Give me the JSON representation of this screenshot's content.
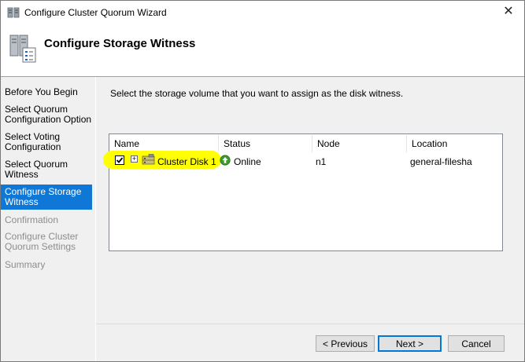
{
  "window": {
    "title": "Configure Cluster Quorum Wizard",
    "close_glyph": "✕"
  },
  "header": {
    "title": "Configure Storage Witness",
    "icon": "cluster-wizard-icon"
  },
  "nav": {
    "items": [
      {
        "label": "Before You Begin",
        "state": "normal"
      },
      {
        "label": "Select Quorum Configuration Option",
        "state": "normal"
      },
      {
        "label": "Select Voting Configuration",
        "state": "normal"
      },
      {
        "label": "Select Quorum Witness",
        "state": "normal"
      },
      {
        "label": "Configure Storage Witness",
        "state": "active"
      },
      {
        "label": "Confirmation",
        "state": "disabled"
      },
      {
        "label": "Configure Cluster Quorum Settings",
        "state": "disabled"
      },
      {
        "label": "Summary",
        "state": "disabled"
      }
    ]
  },
  "main": {
    "instruction": "Select the storage volume that you want to assign as the disk witness.",
    "table": {
      "columns": [
        "Name",
        "Status",
        "Node",
        "Location"
      ],
      "rows": [
        {
          "checked": true,
          "expander": "+",
          "name": "Cluster Disk 1",
          "status": "Online",
          "node": "n1",
          "location": "general-filesha"
        }
      ]
    },
    "highlight_color": "#ffff00"
  },
  "buttons": {
    "previous": "< Previous",
    "next": "Next >",
    "cancel": "Cancel"
  },
  "colors": {
    "active_nav": "#0f78d7",
    "panel_bg": "#f0f0f0",
    "online_status": "#3a9a2a"
  }
}
